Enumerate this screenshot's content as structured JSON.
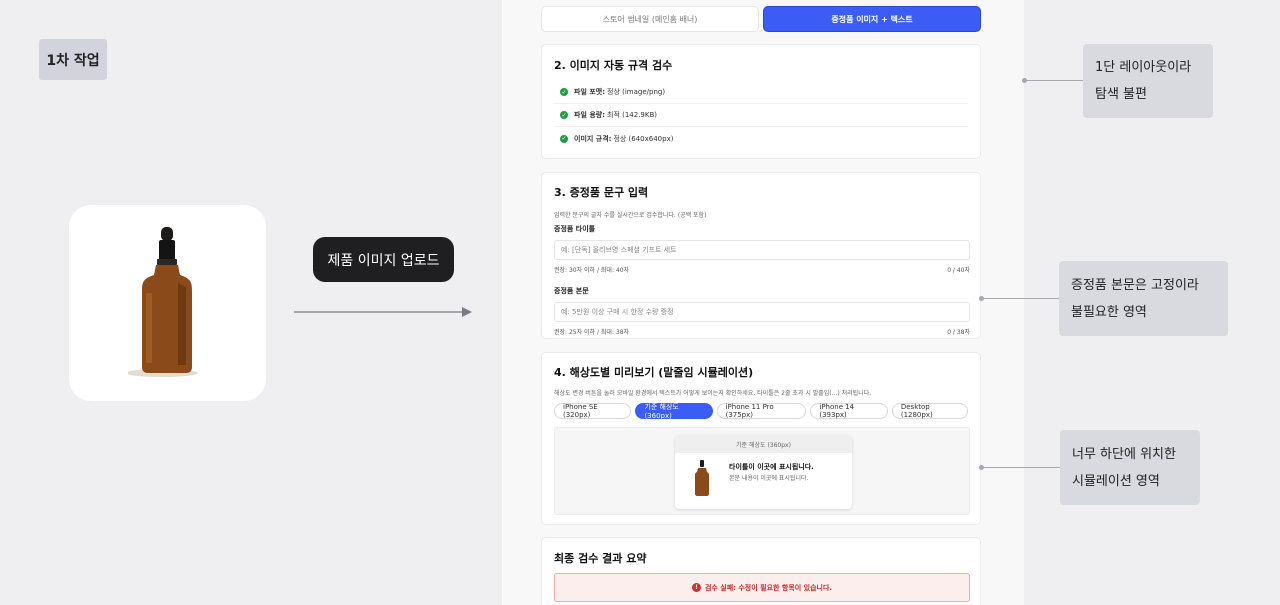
{
  "step_label": "1차 작업",
  "upload_label": "제품 이미지 업로드",
  "tabs": [
    {
      "label": "스토어 썸네일 (메인홈 배너)",
      "active": false
    },
    {
      "label": "증정품 이미지 + 텍스트",
      "active": true
    }
  ],
  "section2": {
    "title": "2. 이미지 자동 규격 검수",
    "checks": [
      {
        "key": "파일 포맷:",
        "value": "정상 (image/png)"
      },
      {
        "key": "파일 용량:",
        "value": "최적 (142.9KB)"
      },
      {
        "key": "이미지 규격:",
        "value": "정상 (640x640px)"
      }
    ]
  },
  "section3": {
    "title": "3. 증정품 문구 입력",
    "hint": "입력한 문구의 글자 수를 실시간으로 검수합니다. (공백 포함)",
    "title_field": {
      "label": "증정품 타이틀",
      "placeholder": "예: [단독] 올리브영 스페셜 기프트 세트",
      "rule": "권장: 30자 이하 / 최대: 40자",
      "count": "0 / 40자"
    },
    "body_field": {
      "label": "증정품 본문",
      "placeholder": "예: 5만원 이상 구매 시 한정 수량 증정",
      "rule": "권장: 25자 이하 / 최대: 38자",
      "count": "0 / 38자"
    }
  },
  "section4": {
    "title": "4. 해상도별 미리보기 (말줄임 시뮬레이션)",
    "hint": "해상도 변경 버튼을 눌러 모바일 환경에서 텍스트가 어떻게 보이는지 확인하세요. 타이틀은 2줄 초과 시 말줄임(...) 처리됩니다.",
    "chips": [
      {
        "label": "iPhone SE (320px)",
        "active": false
      },
      {
        "label": "기준 해상도 (360px)",
        "active": true
      },
      {
        "label": "iPhone 11 Pro (375px)",
        "active": false
      },
      {
        "label": "iPhone 14 (393px)",
        "active": false
      },
      {
        "label": "Desktop (1280px)",
        "active": false
      }
    ],
    "preview": {
      "header": "기준 해상도 (360px)",
      "title": "타이틀이 이곳에 표시됩니다.",
      "body": "본문 내용이 이곳에 표시됩니다."
    }
  },
  "section5": {
    "title": "최종 검수 결과 요약",
    "status": "검수 실패: 수정이 필요한 항목이 있습니다."
  },
  "notes": [
    {
      "lines": [
        "1단 레이아웃이라",
        "탐색 불편"
      ]
    },
    {
      "lines": [
        "증정품 본문은 고정이라",
        "불필요한 영역"
      ]
    },
    {
      "lines": [
        "너무 하단에 위치한",
        "시뮬레이션 영역"
      ]
    }
  ],
  "colors": {
    "accent": "#3b5cf5",
    "success": "#1f9d45",
    "error": "#d32f2f"
  }
}
